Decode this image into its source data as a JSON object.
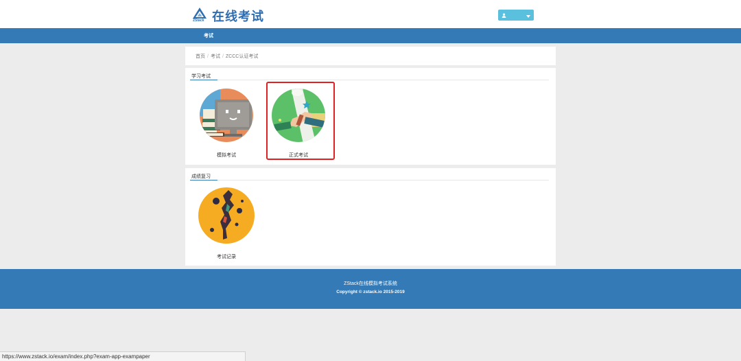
{
  "header": {
    "logo_text": "ZStack",
    "site_title": "在线考试",
    "user": {
      "name": "",
      "icon": "user-icon",
      "caret": "caret-down-icon"
    }
  },
  "nav": {
    "items": [
      {
        "label": "考试"
      }
    ]
  },
  "breadcrumb": {
    "items": [
      "首页",
      "考试",
      "ZCCC认证考试"
    ],
    "separator": "/"
  },
  "sections": [
    {
      "title": "学习考试",
      "tiles": [
        {
          "label": "模拟考试",
          "icon": "computer-screen-illustration"
        },
        {
          "label": "正式考试",
          "icon": "diploma-scroll-illustration",
          "highlighted": true
        }
      ]
    },
    {
      "title": "成绩复习",
      "tiles": [
        {
          "label": "考试记录",
          "icon": "abstract-record-illustration"
        }
      ]
    }
  ],
  "footer": {
    "line1": "ZStack在线模拟考试系统",
    "line2": "Copyright © zstack.io 2015-2019"
  },
  "statusbar": {
    "url": "https://www.zstack.io/exam/index.php?exam-app-exampaper"
  },
  "colors": {
    "primary": "#337ab7",
    "user_button": "#5bc0de",
    "highlight": "#e02020",
    "page_bg": "#ececec"
  }
}
